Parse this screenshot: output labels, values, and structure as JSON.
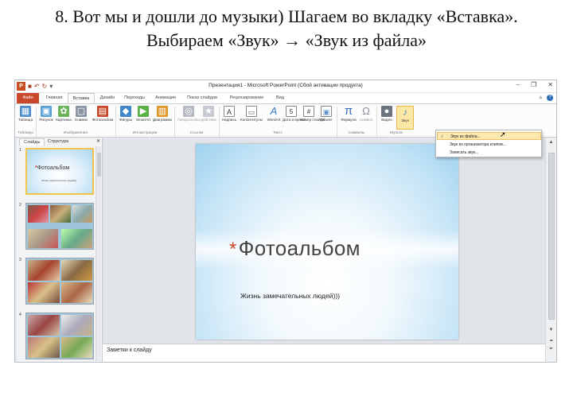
{
  "caption": {
    "line1": "8. Вот мы и дошли до музыки) Шагаем во вкладку «Вставка».",
    "line2": "Выбираем «Звук» → «Звук из файла»"
  },
  "window": {
    "title": "Презентация1 - Microsoft PowerPoint (Сбой активации продукта)",
    "qat_icons": [
      "save-icon",
      "undo-icon",
      "redo-icon"
    ],
    "controls": [
      "–",
      "❐",
      "✕"
    ]
  },
  "tabs": [
    "Файл",
    "Главная",
    "Вставка",
    "Дизайн",
    "Переходы",
    "Анимация",
    "Показ слайдов",
    "Рецензирование",
    "Вид"
  ],
  "active_tab": "Вставка",
  "ribbon": {
    "buttons": [
      {
        "label": "Таблица",
        "icon": "table-icon"
      },
      {
        "label": "Рисунок",
        "icon": "picture-icon"
      },
      {
        "label": "Картинка",
        "icon": "clipart-icon"
      },
      {
        "label": "Снимок",
        "icon": "screenshot-icon"
      },
      {
        "label": "Фотоальбом",
        "icon": "photo-album-icon"
      },
      {
        "label": "Фигуры",
        "icon": "shapes-icon"
      },
      {
        "label": "SmartArt",
        "icon": "smartart-icon"
      },
      {
        "label": "Диаграмма",
        "icon": "chart-icon"
      },
      {
        "label": "Гиперссылка",
        "icon": "hyperlink-icon"
      },
      {
        "label": "Действие",
        "icon": "action-icon"
      },
      {
        "label": "Надпись",
        "icon": "textbox-icon"
      },
      {
        "label": "Колонтитулы",
        "icon": "header-footer-icon"
      },
      {
        "label": "WordArt",
        "icon": "wordart-icon"
      },
      {
        "label": "Дата и время",
        "icon": "datetime-icon"
      },
      {
        "label": "Номер слайда",
        "icon": "slide-number-icon"
      },
      {
        "label": "Объект",
        "icon": "object-icon"
      },
      {
        "label": "Формула",
        "icon": "formula-icon"
      },
      {
        "label": "Символ",
        "icon": "symbol-icon"
      },
      {
        "label": "Видео",
        "icon": "video-icon"
      },
      {
        "label": "Звук",
        "icon": "sound-icon"
      }
    ],
    "groups": [
      "Таблицы",
      "Изображения",
      "Иллюстрации",
      "Ссылки",
      "Текст",
      "Символы",
      "Мульти"
    ]
  },
  "sound_menu": {
    "items": [
      "Звук из файла...",
      "Звук из организатора клипов...",
      "Записать звук..."
    ]
  },
  "slide_panel": {
    "tabs": [
      "Слайды",
      "Структура"
    ],
    "close": "✕",
    "slide_numbers": [
      "1",
      "2",
      "3",
      "4"
    ],
    "thumb1_title": "Фотоальбом",
    "thumb1_sub": "Жизнь замечательных людей)))"
  },
  "slide": {
    "title": "Фотоальбом",
    "subtitle": "Жизнь замечательных людей)))"
  },
  "notes_placeholder": "Заметки к слайду",
  "colors": {
    "file_tab": "#c9472a",
    "highlight": "#fce7a5",
    "accent": "#f3c44a"
  }
}
